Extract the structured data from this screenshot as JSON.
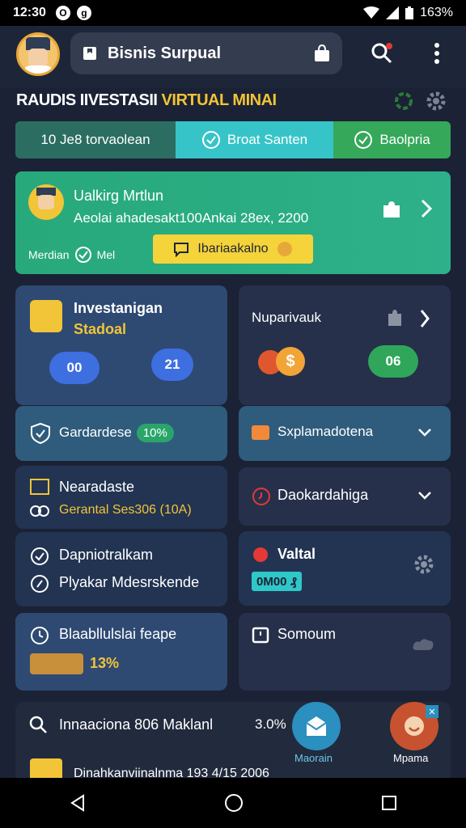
{
  "status": {
    "time": "12:30",
    "g1": "O",
    "g2": "g",
    "battery": "163%"
  },
  "header": {
    "title": "Bisnis Surpual"
  },
  "banner": {
    "title_part1": "RAUDIS IIVESTASII ",
    "title_part2": "VIRTUAL MINAI"
  },
  "tabs": [
    {
      "label": "10  Je8 torvaolean"
    },
    {
      "label": "Broat Santen"
    },
    {
      "label": "Baolpria"
    }
  ],
  "promo": {
    "line1": "Ualkirg Mrtlun",
    "line2": "Aeolai ahadesakt100Ankai 28ex, 2200",
    "line3a": "Merdian",
    "line3b": "Mel",
    "pill": "Ibariaakalno"
  },
  "cards": {
    "invest_title": "Investanigan",
    "invest_sub": "Stadoal",
    "invest_pill1": "00",
    "invest_pill2": "21",
    "nupari": "Nuparivauk",
    "nupari_pill": "06",
    "gardardese": "Gardardese",
    "gardardese_badge": "10%",
    "sxpra": "Sxplamadotena",
    "nearadaste": "Nearadaste",
    "gerantal": "Gerantal Ses306 (10A)",
    "daokard": "Daokardahiga",
    "dapnio": "Dapniotralkam",
    "plyakar": "Plyakar Mdesrskende",
    "valtal": "Valtal",
    "valtal_value": "0M00 ₰",
    "blaab": "Blaabllulslai feape",
    "blaab_pct": "13%",
    "somoum": "Somoum"
  },
  "bottom": {
    "line1": "Innaaciona 806 Maklanl",
    "line1_pct": "3.0%",
    "line2": "Dinahkanviinalnma 193 4/15 2006",
    "fab1": "Maorain",
    "fab2": "Mpama"
  }
}
